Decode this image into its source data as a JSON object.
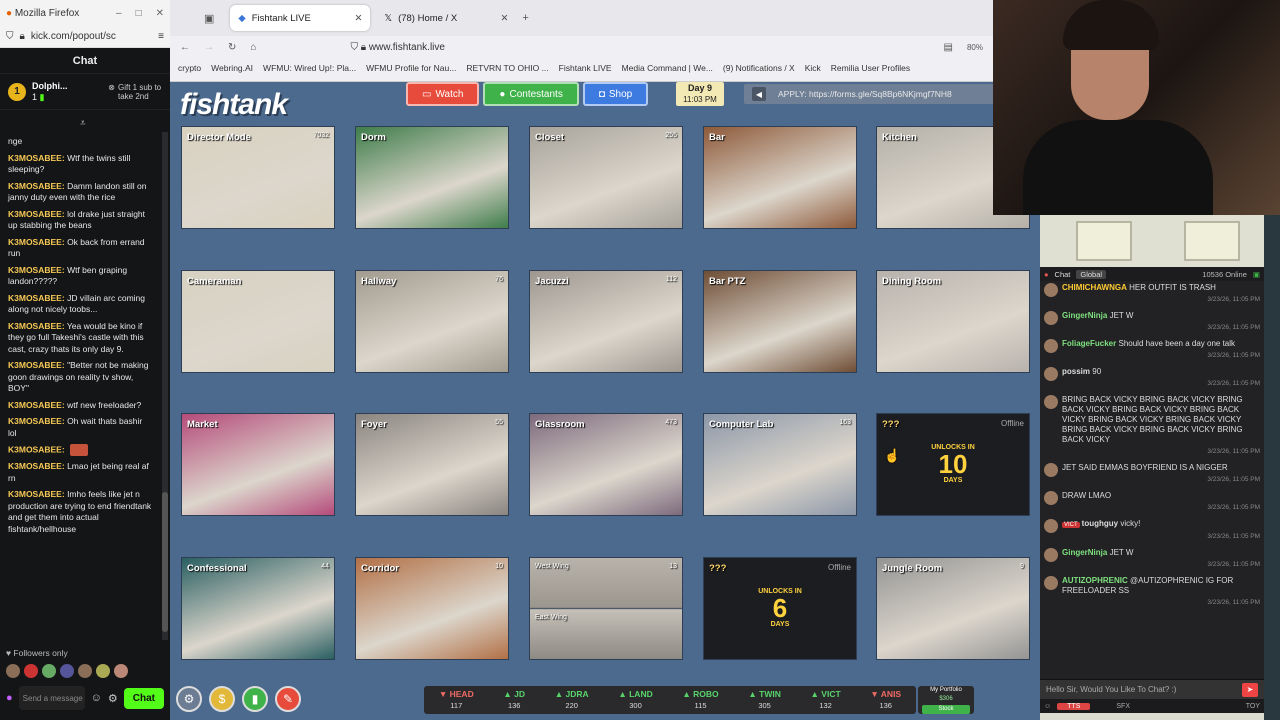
{
  "left_window": {
    "title": "Mozilla Firefox",
    "url": "kick.com/popout/sc",
    "chat_header": "Chat",
    "pinned_user": "Dolphi...",
    "pinned_count": "1",
    "gift_text": "Gift 1 sub to take 2nd",
    "messages": [
      {
        "user": "",
        "text": "nge"
      },
      {
        "user": "K3MOSABEE:",
        "text": "Wtf the twins still sleeping?"
      },
      {
        "user": "K3MOSABEE:",
        "text": "Damm landon still on janny duty even with the rice"
      },
      {
        "user": "K3MOSABEE:",
        "text": "lol drake just straight up stabbing the beans"
      },
      {
        "user": "K3MOSABEE:",
        "text": "Ok back from errand run"
      },
      {
        "user": "K3MOSABEE:",
        "text": "Wtf ben graping landon?????"
      },
      {
        "user": "K3MOSABEE:",
        "text": "JD villain arc coming along not nicely toobs..."
      },
      {
        "user": "K3MOSABEE:",
        "text": "Yea would be kino if they go full Takeshi's castle with this cast, crazy thats its only day 9."
      },
      {
        "user": "K3MOSABEE:",
        "text": "\"Better not be making goon drawings on reality tv show, BOY\""
      },
      {
        "user": "K3MOSABEE:",
        "text": "wtf new freeloader?"
      },
      {
        "user": "K3MOSABEE:",
        "text": "Oh wait thats bashir lol"
      },
      {
        "user": "K3MOSABEE:",
        "text": ""
      },
      {
        "user": "K3MOSABEE:",
        "text": "Lmao jet being real af rn"
      },
      {
        "user": "K3MOSABEE:",
        "text": "Imho feels like jet n production are trying to end friendtank and get them into actual fishtank/hellhouse"
      }
    ],
    "followers_only": "Followers only",
    "send_placeholder": "Send a message",
    "chat_button": "Chat"
  },
  "browser": {
    "tabs": [
      {
        "title": "Fishtank LIVE",
        "active": true
      },
      {
        "title": "(78) Home / X",
        "active": false
      }
    ],
    "url": "www.fishtank.live",
    "zoom": "80%",
    "bookmarks": [
      "crypto",
      "Webring.AI",
      "WFMU: Wired Up!: Pla...",
      "WFMU Profile for Nau...",
      "RETVRN TO OHIO ...",
      "Fishtank LIVE",
      "Media Command | We...",
      "(9) Notifications / X",
      "Kick",
      "Remilia User Profiles"
    ]
  },
  "fishtank": {
    "logo": "fishtank",
    "buttons": {
      "watch": "Watch",
      "contestants": "Contestants",
      "shop": "Shop"
    },
    "day": "Day 9",
    "time": "11:03 PM",
    "apply_text": "APPLY: https://forms.gle/Sq8Bp6NKjmgf7NH8",
    "cams": [
      {
        "label": "Director Mode",
        "count": "7032",
        "color": "#d9d2c0"
      },
      {
        "label": "Dorm",
        "count": "",
        "color": "#3f7d4a"
      },
      {
        "label": "Closet",
        "count": "255",
        "color": "#a7a39a"
      },
      {
        "label": "Bar",
        "count": "",
        "color": "#8e5a3a"
      },
      {
        "label": "Kitchen",
        "count": "",
        "color": "#b4b0a7"
      },
      {
        "label": "Cameraman",
        "count": "",
        "color": "#d8d2c2"
      },
      {
        "label": "Hallway",
        "count": "76",
        "color": "#a29b8f"
      },
      {
        "label": "Jacuzzi",
        "count": "112",
        "color": "#9d9790"
      },
      {
        "label": "Bar PTZ",
        "count": "",
        "color": "#6f4e36"
      },
      {
        "label": "Dining Room",
        "count": "",
        "color": "#b7b2ac"
      },
      {
        "label": "Market",
        "count": "",
        "color": "#b54b7a"
      },
      {
        "label": "Foyer",
        "count": "55",
        "color": "#8a8580"
      },
      {
        "label": "Glassroom",
        "count": "473",
        "color": "#7d6a7d"
      },
      {
        "label": "Computer Lab",
        "count": "163",
        "color": "#8c97a8"
      },
      {
        "label": "Confessional",
        "count": "44",
        "color": "#2a5f62"
      },
      {
        "label": "Corridor",
        "count": "10",
        "color": "#b27046"
      },
      {
        "label": "Jungle Room",
        "count": "9",
        "color": "#949494"
      }
    ],
    "split_cam": {
      "top": "West Wing",
      "bottom": "East Wing",
      "count": "13"
    },
    "locked": [
      {
        "label": "???",
        "status": "Offline",
        "unlocks": "UNLOCKS IN",
        "number": "10",
        "unit": "DAYS"
      },
      {
        "label": "???",
        "status": "Offline",
        "unlocks": "UNLOCKS IN",
        "number": "6",
        "unit": "DAYS"
      }
    ],
    "scores": [
      {
        "name": "HEAD",
        "value": "117",
        "dir": "dn"
      },
      {
        "name": "JD",
        "value": "136",
        "dir": "up"
      },
      {
        "name": "JDRA",
        "value": "220",
        "dir": "up"
      },
      {
        "name": "LAND",
        "value": "300",
        "dir": "up"
      },
      {
        "name": "ROBO",
        "value": "115",
        "dir": "up"
      },
      {
        "name": "TWIN",
        "value": "305",
        "dir": "up"
      },
      {
        "name": "VICT",
        "value": "132",
        "dir": "up"
      },
      {
        "name": "ANIS",
        "value": "136",
        "dir": "dn"
      }
    ],
    "portfolio_title": "My Portfolio",
    "portfolio_value": "$306",
    "portfolio_stock": "Stock"
  },
  "right_chat": {
    "tab_chat": "Chat",
    "tab_global": "Global",
    "online": "10536 Online",
    "messages": [
      {
        "user": "CHIMICHAWNGA",
        "text": "HER OUTFIT IS TRASH",
        "time": "3/23/26, 11:05 PM",
        "cls": "y"
      },
      {
        "user": "GingerNinja",
        "text": "JET W",
        "time": "3/23/26, 11:05 PM",
        "cls": "g"
      },
      {
        "user": "FoliageFucker",
        "text": "Should have been a day one talk",
        "time": "3/23/26, 11:05 PM",
        "cls": "g"
      },
      {
        "user": "possim",
        "text": "90",
        "time": "3/23/26, 11:05 PM",
        "cls": ""
      },
      {
        "user": "",
        "text": "BRING BACK VICKY BRING BACK VICKY BRING BACK VICKY BRING BACK VICKY BRING BACK VICKY BRING BACK VICKY BRING BACK VICKY BRING BACK VICKY BRING BACK VICKY BRING BACK VICKY",
        "time": "3/23/26, 11:05 PM",
        "cls": "r"
      },
      {
        "user": "",
        "text": "JET SAID EMMAS BOYFRIEND IS A NIGGER",
        "time": "3/23/26, 11:05 PM",
        "cls": "r"
      },
      {
        "user": "",
        "text": "DRAW LMAO",
        "time": "3/23/26, 11:05 PM",
        "cls": "p"
      },
      {
        "user": "toughguy",
        "text": "vicky!",
        "time": "3/23/26, 11:05 PM",
        "cls": "",
        "badge": "VICT"
      },
      {
        "user": "GingerNinja",
        "text": "JET W",
        "time": "3/23/26, 11:05 PM",
        "cls": "g"
      },
      {
        "user": "AUTIZOPHRENIC",
        "text": "@AUTIZOPHRENIC IG FOR FREELOADER SS",
        "time": "3/23/26, 11:05 PM",
        "cls": "g"
      }
    ],
    "input_placeholder": "Hello Sir, Would You Like To Chat? :)",
    "tts": "TTS",
    "sfx": "SFX",
    "toy": "TOY"
  }
}
